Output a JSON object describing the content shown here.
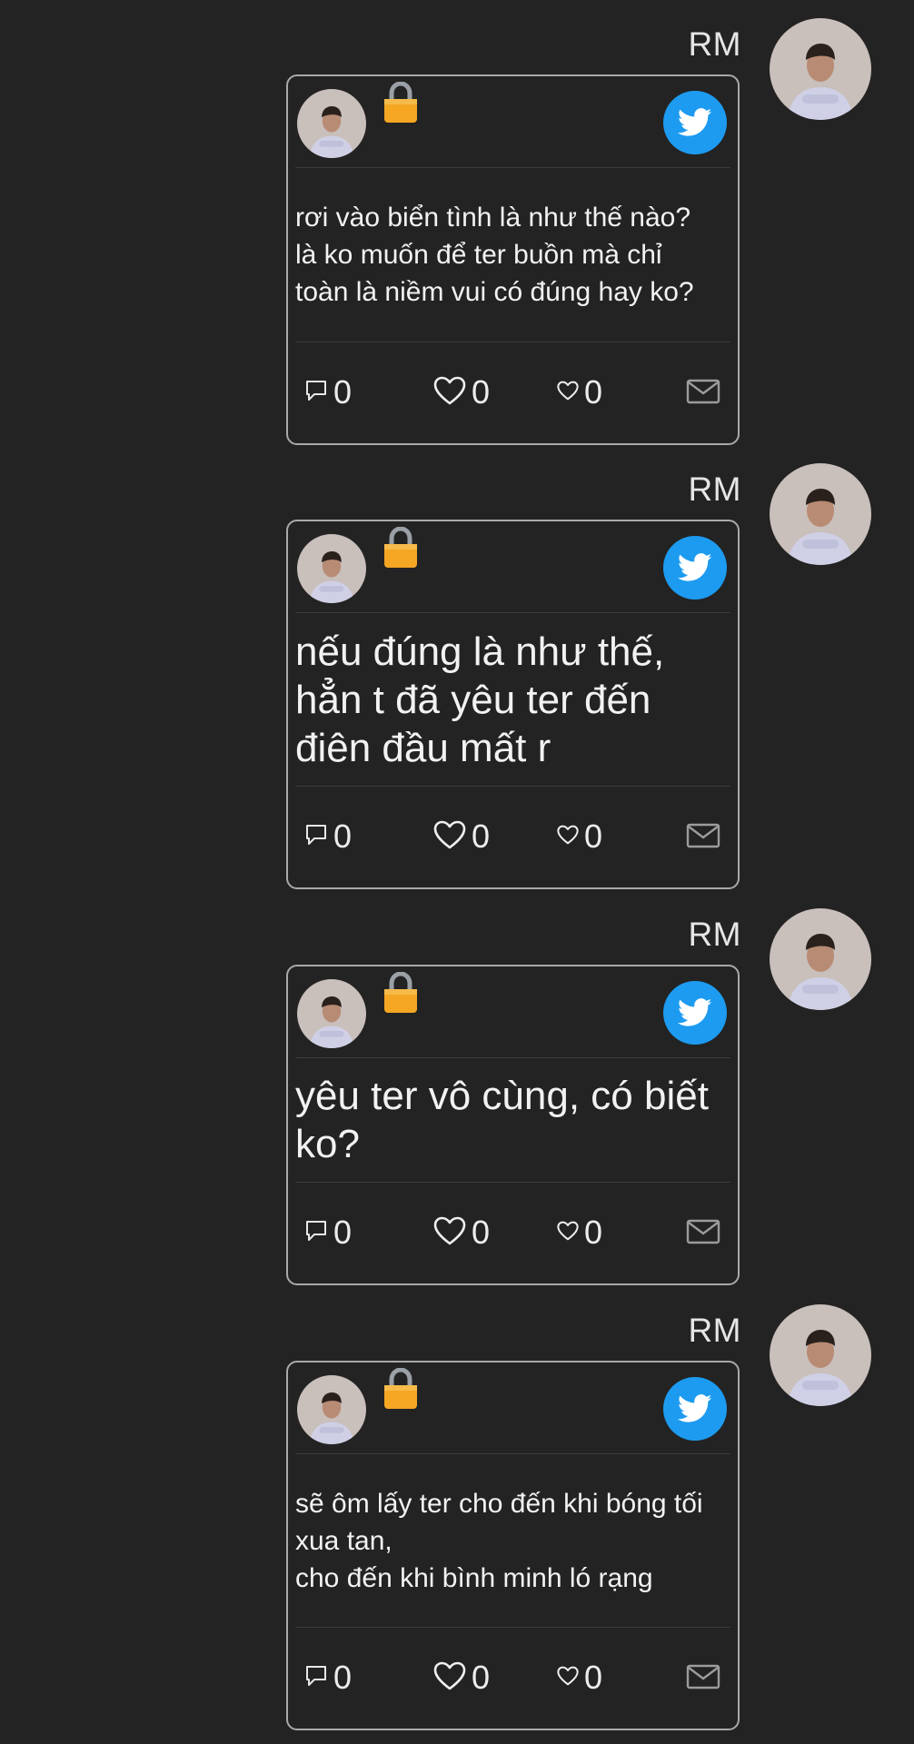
{
  "messages": [
    {
      "sender": "RM",
      "text": "rơi vào biển tình là như thế nào?\nlà ko muốn để ter buồn mà chỉ\ntoàn là niềm vui có đúng hay ko?",
      "comments": "0",
      "likes": "0",
      "favorites": "0"
    },
    {
      "sender": "RM",
      "text": "nếu đúng là như thế,\nhẳn t đã yêu ter đến\nđiên đầu mất r",
      "comments": "0",
      "likes": "0",
      "favorites": "0"
    },
    {
      "sender": "RM",
      "text": "yêu ter vô cùng, có biết\nko?",
      "comments": "0",
      "likes": "0",
      "favorites": "0"
    },
    {
      "sender": "RM",
      "text": "sẽ ôm lấy ter cho đến khi bóng tối\nxua tan,\ncho đến khi bình minh ló rạng",
      "comments": "0",
      "likes": "0",
      "favorites": "0"
    }
  ],
  "icons": {
    "lock": "lock-icon",
    "brand": "twitter-bird-icon",
    "comment": "speech-bubble-icon",
    "like": "heart-outline-icon",
    "favorite": "small-heart-icon",
    "message": "envelope-icon"
  },
  "colors": {
    "background": "#232323",
    "twitter_blue": "#1d9bf0",
    "lock_gold": "#f5a623",
    "card_border": "#a9a9a9"
  }
}
